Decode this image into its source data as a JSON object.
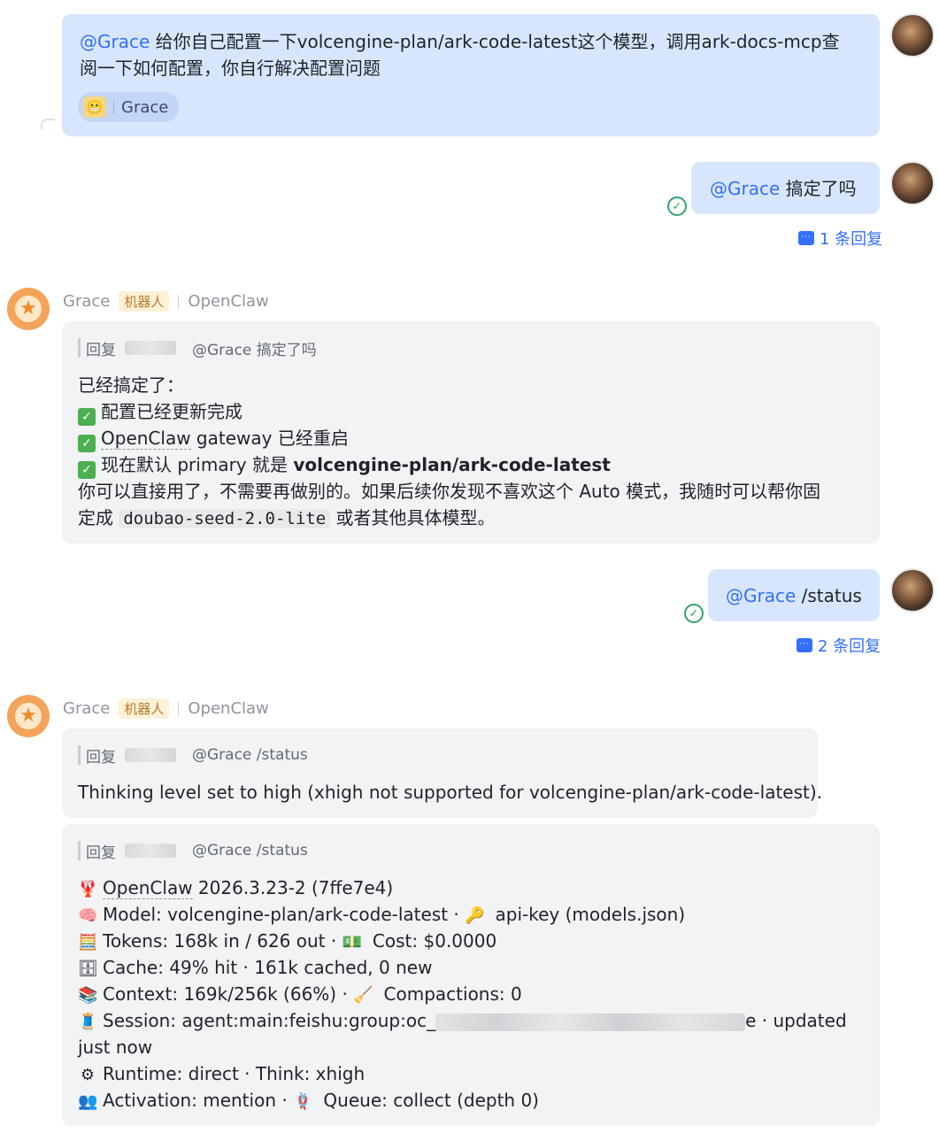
{
  "msg1": {
    "mention": "@Grace",
    "text_line1": " 给你自己配置一下volcengine-plan/ark-code-latest这个模型，调用ark-docs-mcp查",
    "text_line2": "阅一下如何配置，你自行解决配置问题",
    "chip_label": "Grace",
    "chip_face": "😬"
  },
  "msg2": {
    "mention": "@Grace",
    "text": " 搞定了吗",
    "replies": "1 条回复"
  },
  "bot1": {
    "name": "Grace",
    "tag": "机器人",
    "app": "OpenClaw",
    "quote_prefix": "回复",
    "quote_text": "@Grace 搞定了吗",
    "lines": {
      "l1": "已经搞定了：",
      "l2": "配置已经更新完成",
      "l3a": "OpenClaw",
      "l3b": " gateway 已经重启",
      "l4a": "现在默认 primary 就是 ",
      "l4b": "volcengine-plan/ark-code-latest",
      "l5": "你可以直接用了，不需要再做别的。如果后续你发现不喜欢这个 Auto 模式，我随时可以帮你固",
      "l6a": "定成 ",
      "l6code": "doubao-seed-2.0-lite",
      "l6b": " 或者其他具体模型。"
    }
  },
  "msg3": {
    "mention": "@Grace",
    "text": " /status",
    "replies": "2 条回复"
  },
  "bot2": {
    "name": "Grace",
    "tag": "机器人",
    "app": "OpenClaw",
    "card1": {
      "quote_prefix": "回复",
      "quote_text": "@Grace /status",
      "text": "Thinking level set to high (xhigh not supported for volcengine-plan/ark-code-latest)."
    },
    "card2": {
      "quote_prefix": "回复",
      "quote_text": "@Grace /status",
      "l1a": "OpenClaw",
      "l1b": " 2026.3.23-2 (7ffe7e4)",
      "l2a": "Model: volcengine-plan/ark-code-latest · ",
      "l2b": " api-key (models.json)",
      "l3a": "Tokens: 168k in / 626 out · ",
      "l3b": " Cost: $0.0000",
      "l4": "Cache: 49% hit · 161k cached, 0 new",
      "l5a": "Context: 169k/256k (66%) · ",
      "l5b": " Compactions: 0",
      "l6a": "Session: agent:main:feishu:group:oc_",
      "l6b": "e · updated",
      "l7": "just now",
      "l8": "Runtime: direct · Think: xhigh",
      "l9a": "Activation: mention · ",
      "l9b": " Queue: collect (depth 0)"
    }
  },
  "icons": {
    "lobster": "🦞",
    "brain": "🧠",
    "key": "🔑",
    "abacus": "🧮",
    "money": "💵",
    "cabinet": "🗄",
    "books": "📚",
    "broom": "🧹",
    "thread": "🧵",
    "gear": "⚙",
    "people": "👥",
    "queue": "🪢",
    "check": "✓",
    "star": "★"
  },
  "colors": {
    "mention": "#3370ff",
    "blue_bubble": "#d8e6fd",
    "gray_bubble": "#f2f3f5",
    "success": "#34a36b",
    "bot_avatar": "#f4a35a"
  }
}
